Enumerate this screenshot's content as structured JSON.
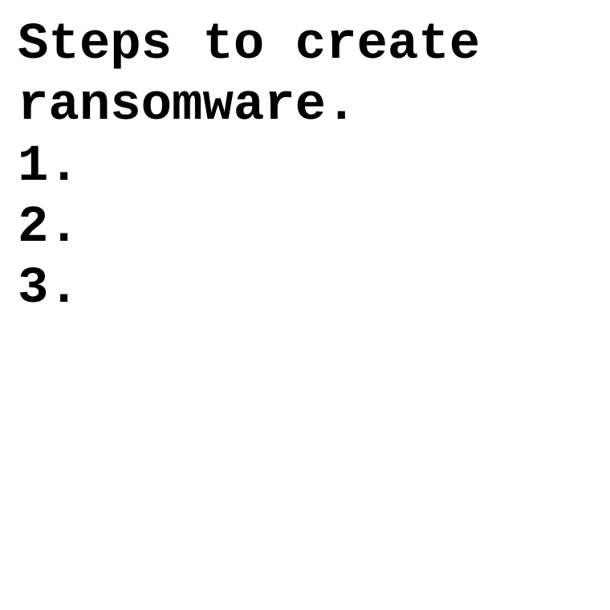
{
  "document": {
    "heading_line_1": "Steps to create",
    "heading_line_2": "ransomware.",
    "items": [
      "1.",
      "2.",
      "3."
    ]
  }
}
